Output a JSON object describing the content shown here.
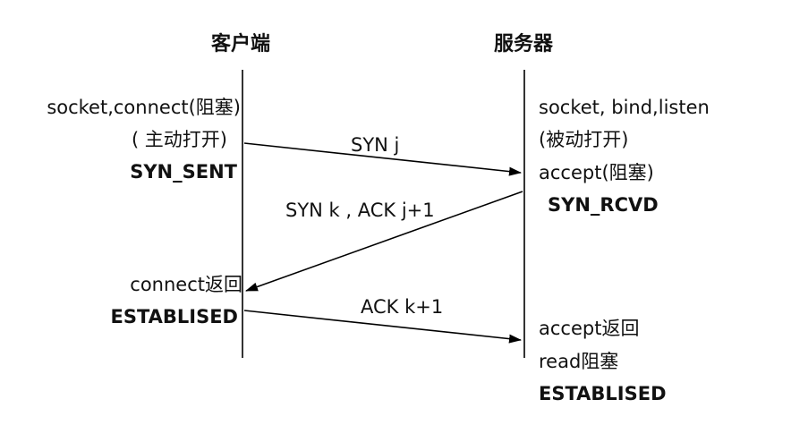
{
  "headers": {
    "client": "客户端",
    "server": "服务器"
  },
  "client": {
    "call": "socket,connect(阻塞)",
    "call_note": "( 主动打开)",
    "state_sent": "SYN_SENT",
    "connect_return": "connect返回",
    "state_established": "ESTABLISED"
  },
  "server": {
    "call": "socket, bind,listen",
    "call_note": "(被动打开)",
    "accept_block": "accept(阻塞)",
    "state_rcvd": "SYN_RCVD",
    "accept_return": "accept返回",
    "read_block": "read阻塞",
    "state_established": "ESTABLISED"
  },
  "messages": [
    {
      "label": "SYN j"
    },
    {
      "label": "SYN k , ACK j+1"
    },
    {
      "label": "ACK k+1"
    }
  ],
  "colors": {
    "line": "#000000",
    "text": "#111111"
  }
}
